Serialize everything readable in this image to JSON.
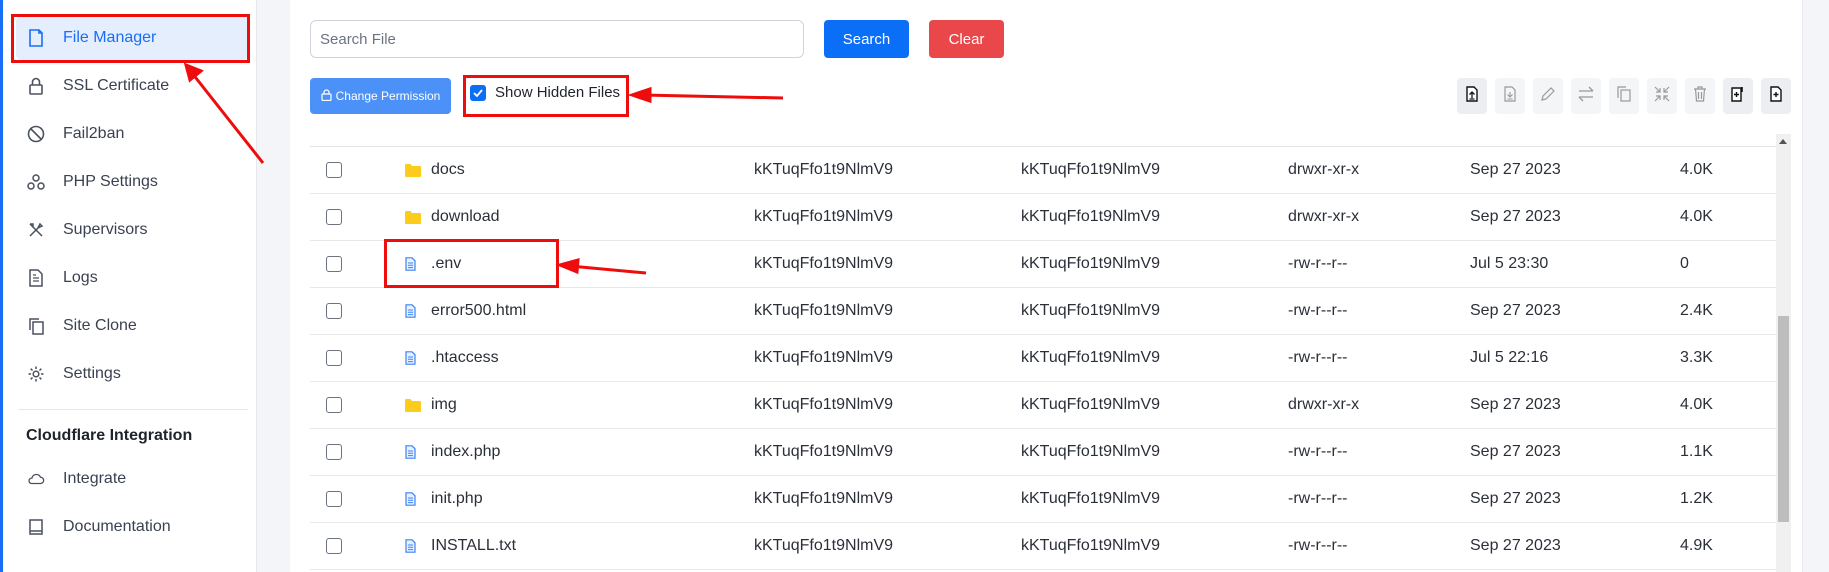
{
  "sidebar": {
    "items": [
      {
        "label": "File Manager",
        "icon": "file-icon",
        "active": true
      },
      {
        "label": "SSL Certificate",
        "icon": "lock-icon"
      },
      {
        "label": "Fail2ban",
        "icon": "ban-icon"
      },
      {
        "label": "PHP Settings",
        "icon": "nodes-icon"
      },
      {
        "label": "Supervisors",
        "icon": "tools-icon"
      },
      {
        "label": "Logs",
        "icon": "document-icon"
      },
      {
        "label": "Site Clone",
        "icon": "copy-icon"
      },
      {
        "label": "Settings",
        "icon": "gear-icon"
      }
    ],
    "section_title": "Cloudflare Integration",
    "section_items": [
      {
        "label": "Integrate",
        "icon": "cloud-icon"
      },
      {
        "label": "Documentation",
        "icon": "book-icon"
      }
    ]
  },
  "search": {
    "placeholder": "Search File",
    "value": "",
    "search_label": "Search",
    "clear_label": "Clear"
  },
  "actions": {
    "change_permission_label": "Change Permission",
    "show_hidden_label": "Show Hidden Files",
    "show_hidden_checked": true
  },
  "toolbar": [
    {
      "name": "upload-file",
      "icon": "upload-file-icon"
    },
    {
      "name": "download-file",
      "icon": "download-file-icon"
    },
    {
      "name": "rename",
      "icon": "pencil-icon"
    },
    {
      "name": "move",
      "icon": "swap-icon"
    },
    {
      "name": "copy",
      "icon": "copy-icon"
    },
    {
      "name": "compress",
      "icon": "compress-icon"
    },
    {
      "name": "delete",
      "icon": "trash-icon"
    },
    {
      "name": "new-folder",
      "icon": "new-folder-icon"
    },
    {
      "name": "new-file",
      "icon": "new-file-icon"
    }
  ],
  "files": [
    {
      "type": "folder",
      "name": "docs",
      "owner": "kKTuqFfo1t9NlmV9",
      "group": "kKTuqFfo1t9NlmV9",
      "permissions": "drwxr-xr-x",
      "modified": "Sep 27 2023",
      "size": "4.0K"
    },
    {
      "type": "folder",
      "name": "download",
      "owner": "kKTuqFfo1t9NlmV9",
      "group": "kKTuqFfo1t9NlmV9",
      "permissions": "drwxr-xr-x",
      "modified": "Sep 27 2023",
      "size": "4.0K"
    },
    {
      "type": "file",
      "name": ".env",
      "owner": "kKTuqFfo1t9NlmV9",
      "group": "kKTuqFfo1t9NlmV9",
      "permissions": "-rw-r--r--",
      "modified": "Jul 5 23:30",
      "size": "0"
    },
    {
      "type": "file",
      "name": "error500.html",
      "owner": "kKTuqFfo1t9NlmV9",
      "group": "kKTuqFfo1t9NlmV9",
      "permissions": "-rw-r--r--",
      "modified": "Sep 27 2023",
      "size": "2.4K"
    },
    {
      "type": "file",
      "name": ".htaccess",
      "owner": "kKTuqFfo1t9NlmV9",
      "group": "kKTuqFfo1t9NlmV9",
      "permissions": "-rw-r--r--",
      "modified": "Jul 5 22:16",
      "size": "3.3K"
    },
    {
      "type": "folder",
      "name": "img",
      "owner": "kKTuqFfo1t9NlmV9",
      "group": "kKTuqFfo1t9NlmV9",
      "permissions": "drwxr-xr-x",
      "modified": "Sep 27 2023",
      "size": "4.0K"
    },
    {
      "type": "file",
      "name": "index.php",
      "owner": "kKTuqFfo1t9NlmV9",
      "group": "kKTuqFfo1t9NlmV9",
      "permissions": "-rw-r--r--",
      "modified": "Sep 27 2023",
      "size": "1.1K"
    },
    {
      "type": "file",
      "name": "init.php",
      "owner": "kKTuqFfo1t9NlmV9",
      "group": "kKTuqFfo1t9NlmV9",
      "permissions": "-rw-r--r--",
      "modified": "Sep 27 2023",
      "size": "1.2K"
    },
    {
      "type": "file",
      "name": "INSTALL.txt",
      "owner": "kKTuqFfo1t9NlmV9",
      "group": "kKTuqFfo1t9NlmV9",
      "permissions": "-rw-r--r--",
      "modified": "Sep 27 2023",
      "size": "4.9K"
    }
  ],
  "colors": {
    "primary": "#0b6ef6",
    "danger": "#e9474a",
    "folder": "#fccc1c",
    "file_icon": "#3b82f6",
    "annotation": "#ee0c0c"
  }
}
